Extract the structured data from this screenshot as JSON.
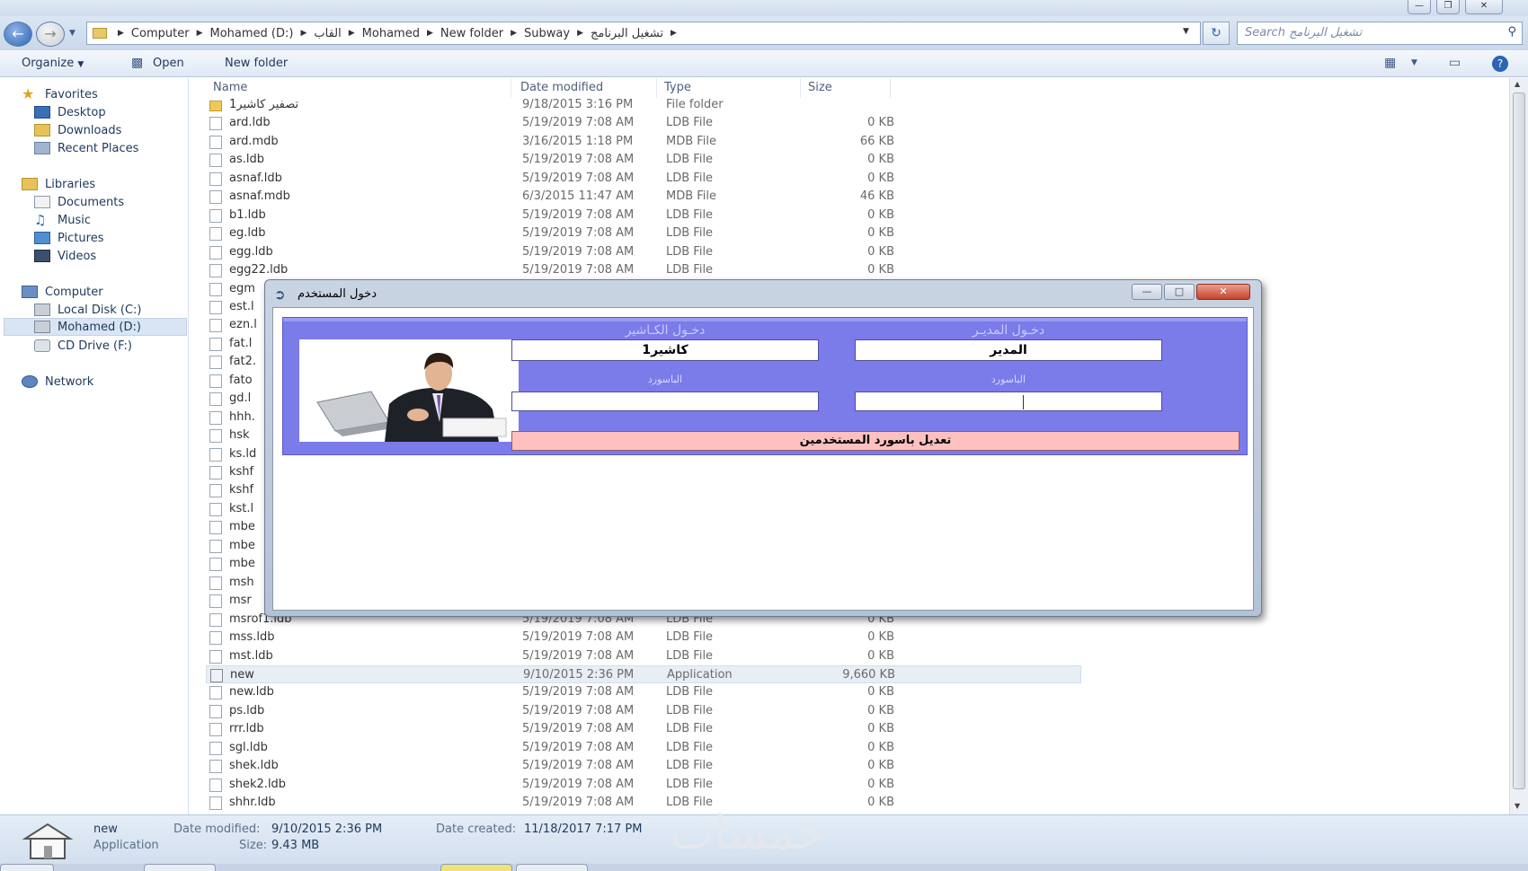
{
  "window": {
    "buttons": {
      "minimize": "—",
      "maximize": "❐",
      "close": "✕"
    }
  },
  "address": {
    "crumbs": [
      "Computer",
      "Mohamed (D:)",
      "القاب",
      "Mohamed",
      "New folder",
      "Subway",
      "تشغيل البرنامج"
    ],
    "search_placeholder": "Search تشغيل البرنامج"
  },
  "toolbar": {
    "organize": "Organize",
    "open": "Open",
    "new_folder": "New folder"
  },
  "nav": {
    "favorites": "Favorites",
    "desktop": "Desktop",
    "downloads": "Downloads",
    "recent_places": "Recent Places",
    "libraries": "Libraries",
    "documents": "Documents",
    "music": "Music",
    "pictures": "Pictures",
    "videos": "Videos",
    "computer": "Computer",
    "local_disk": "Local Disk (C:)",
    "mohamed_d": "Mohamed (D:)",
    "cd_drive": "CD Drive (F:)",
    "network": "Network"
  },
  "columns": {
    "name": "Name",
    "date": "Date modified",
    "type": "Type",
    "size": "Size"
  },
  "files": [
    {
      "name": "تصفير كاشير1",
      "date": "9/18/2015 3:16 PM",
      "type": "File folder",
      "size": ""
    },
    {
      "name": "ard.ldb",
      "date": "5/19/2019 7:08 AM",
      "type": "LDB File",
      "size": "0 KB"
    },
    {
      "name": "ard.mdb",
      "date": "3/16/2015 1:18 PM",
      "type": "MDB File",
      "size": "66 KB"
    },
    {
      "name": "as.ldb",
      "date": "5/19/2019 7:08 AM",
      "type": "LDB File",
      "size": "0 KB"
    },
    {
      "name": "asnaf.ldb",
      "date": "5/19/2019 7:08 AM",
      "type": "LDB File",
      "size": "0 KB"
    },
    {
      "name": "asnaf.mdb",
      "date": "6/3/2015 11:47 AM",
      "type": "MDB File",
      "size": "46 KB"
    },
    {
      "name": "b1.ldb",
      "date": "5/19/2019 7:08 AM",
      "type": "LDB File",
      "size": "0 KB"
    },
    {
      "name": "eg.ldb",
      "date": "5/19/2019 7:08 AM",
      "type": "LDB File",
      "size": "0 KB"
    },
    {
      "name": "egg.ldb",
      "date": "5/19/2019 7:08 AM",
      "type": "LDB File",
      "size": "0 KB"
    },
    {
      "name": "egg22.ldb",
      "date": "5/19/2019 7:08 AM",
      "type": "LDB File",
      "size": "0 KB"
    },
    {
      "name": "egm",
      "date": "",
      "type": "",
      "size": ""
    },
    {
      "name": "est.l",
      "date": "",
      "type": "",
      "size": ""
    },
    {
      "name": "ezn.l",
      "date": "",
      "type": "",
      "size": ""
    },
    {
      "name": "fat.l",
      "date": "",
      "type": "",
      "size": ""
    },
    {
      "name": "fat2.",
      "date": "",
      "type": "",
      "size": ""
    },
    {
      "name": "fato",
      "date": "",
      "type": "",
      "size": ""
    },
    {
      "name": "gd.l",
      "date": "",
      "type": "",
      "size": ""
    },
    {
      "name": "hhh.",
      "date": "",
      "type": "",
      "size": ""
    },
    {
      "name": "hsk",
      "date": "",
      "type": "",
      "size": ""
    },
    {
      "name": "ks.ld",
      "date": "",
      "type": "",
      "size": ""
    },
    {
      "name": "kshf",
      "date": "",
      "type": "",
      "size": ""
    },
    {
      "name": "kshf",
      "date": "",
      "type": "",
      "size": ""
    },
    {
      "name": "kst.l",
      "date": "",
      "type": "",
      "size": ""
    },
    {
      "name": "mbe",
      "date": "",
      "type": "",
      "size": ""
    },
    {
      "name": "mbe",
      "date": "",
      "type": "",
      "size": ""
    },
    {
      "name": "mbe",
      "date": "",
      "type": "",
      "size": ""
    },
    {
      "name": "msh",
      "date": "",
      "type": "",
      "size": ""
    },
    {
      "name": "msr",
      "date": "",
      "type": "",
      "size": ""
    },
    {
      "name": "msrof1.ldb",
      "date": "5/19/2019 7:08 AM",
      "type": "LDB File",
      "size": "0 KB"
    },
    {
      "name": "mss.ldb",
      "date": "5/19/2019 7:08 AM",
      "type": "LDB File",
      "size": "0 KB"
    },
    {
      "name": "mst.ldb",
      "date": "5/19/2019 7:08 AM",
      "type": "LDB File",
      "size": "0 KB"
    },
    {
      "name": "new",
      "date": "9/10/2015 2:36 PM",
      "type": "Application",
      "size": "9,660 KB"
    },
    {
      "name": "new.ldb",
      "date": "5/19/2019 7:08 AM",
      "type": "LDB File",
      "size": "0 KB"
    },
    {
      "name": "ps.ldb",
      "date": "5/19/2019 7:08 AM",
      "type": "LDB File",
      "size": "0 KB"
    },
    {
      "name": "rrr.ldb",
      "date": "5/19/2019 7:08 AM",
      "type": "LDB File",
      "size": "0 KB"
    },
    {
      "name": "sgl.ldb",
      "date": "5/19/2019 7:08 AM",
      "type": "LDB File",
      "size": "0 KB"
    },
    {
      "name": "shek.ldb",
      "date": "5/19/2019 7:08 AM",
      "type": "LDB File",
      "size": "0 KB"
    },
    {
      "name": "shek2.ldb",
      "date": "5/19/2019 7:08 AM",
      "type": "LDB File",
      "size": "0 KB"
    },
    {
      "name": "shhr.ldb",
      "date": "5/19/2019 7:08 AM",
      "type": "LDB File",
      "size": "0 KB"
    }
  ],
  "details": {
    "name": "new",
    "kind": "Application",
    "date_modified_label": "Date modified:",
    "date_modified": "9/10/2015 2:36 PM",
    "size_label": "Size:",
    "size": "9.43 MB",
    "date_created_label": "Date created:",
    "date_created": "11/18/2017 7:17 PM"
  },
  "watermark": "خمسات",
  "dialog": {
    "title": "دخول المستخدم",
    "cashier_login": "دخـول الكـاشير",
    "manager_login": "دخـول المديـر",
    "cashier_user": "كاشير1",
    "manager_user": "المدير",
    "cashier_pw_label": "الباسورد",
    "manager_pw_label": "الباسورد",
    "cashier_pw": "",
    "manager_pw": "",
    "change_pw_button": "تعديل باسورد المستخدمين",
    "panel_color": "#7b7bea",
    "button_color": "#ffc0c0"
  }
}
